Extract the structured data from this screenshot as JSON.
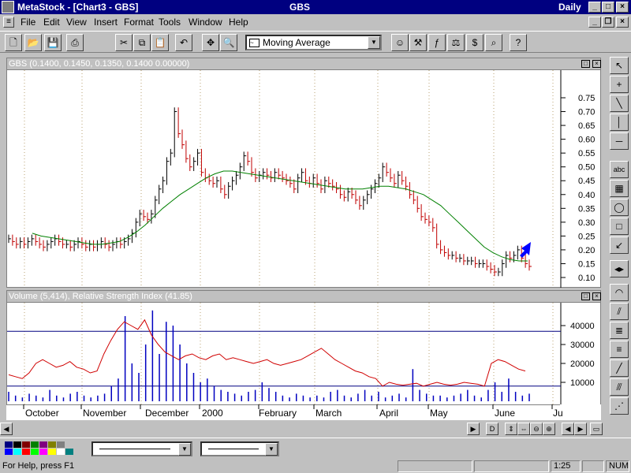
{
  "titlebar": {
    "app": "MetaStock - [Chart3 - GBS]",
    "center": "GBS",
    "right": "Daily"
  },
  "menu": [
    "File",
    "Edit",
    "View",
    "Insert",
    "Format",
    "Tools",
    "Window",
    "Help"
  ],
  "toolbar": {
    "indicator_select": "Moving Average"
  },
  "price_pane": {
    "header": "GBS (0.1400, 0.1450, 0.1350, 0.1400 0.00000)",
    "yticks": [
      "0.75",
      "0.70",
      "0.65",
      "0.60",
      "0.55",
      "0.50",
      "0.45",
      "0.40",
      "0.35",
      "0.30",
      "0.25",
      "0.20",
      "0.15",
      "0.10"
    ]
  },
  "volume_pane": {
    "header": "Volume (5,414), Relative Strength Index (41.85)",
    "yticks": [
      "40000",
      "30000",
      "20000",
      "10000"
    ]
  },
  "xaxis": {
    "labels": [
      "October",
      "November",
      "December",
      "2000",
      "February",
      "March",
      "April",
      "May",
      "June",
      "Ju"
    ]
  },
  "status": {
    "help": "For Help, press F1",
    "time": "1:25",
    "num": "NUM"
  },
  "chart_data": {
    "type": "line",
    "price": {
      "close": [
        0.24,
        0.23,
        0.22,
        0.23,
        0.22,
        0.23,
        0.24,
        0.23,
        0.22,
        0.21,
        0.22,
        0.23,
        0.24,
        0.23,
        0.22,
        0.22,
        0.21,
        0.22,
        0.23,
        0.22,
        0.21,
        0.22,
        0.21,
        0.22,
        0.23,
        0.22,
        0.21,
        0.22,
        0.23,
        0.22,
        0.23,
        0.24,
        0.26,
        0.3,
        0.33,
        0.32,
        0.31,
        0.33,
        0.38,
        0.42,
        0.45,
        0.52,
        0.55,
        0.7,
        0.62,
        0.58,
        0.53,
        0.5,
        0.52,
        0.55,
        0.48,
        0.46,
        0.45,
        0.44,
        0.45,
        0.42,
        0.4,
        0.43,
        0.45,
        0.47,
        0.5,
        0.54,
        0.52,
        0.48,
        0.46,
        0.47,
        0.48,
        0.47,
        0.46,
        0.48,
        0.47,
        0.46,
        0.45,
        0.44,
        0.42,
        0.46,
        0.48,
        0.45,
        0.44,
        0.46,
        0.44,
        0.42,
        0.45,
        0.44,
        0.43,
        0.42,
        0.4,
        0.39,
        0.41,
        0.4,
        0.38,
        0.36,
        0.38,
        0.4,
        0.42,
        0.44,
        0.46,
        0.5,
        0.48,
        0.46,
        0.44,
        0.47,
        0.45,
        0.43,
        0.4,
        0.38,
        0.35,
        0.32,
        0.31,
        0.3,
        0.28,
        0.22,
        0.2,
        0.19,
        0.18,
        0.18,
        0.17,
        0.17,
        0.16,
        0.16,
        0.16,
        0.15,
        0.15,
        0.15,
        0.14,
        0.13,
        0.12,
        0.12,
        0.15,
        0.18,
        0.17,
        0.18,
        0.2,
        0.17,
        0.15,
        0.14
      ],
      "moving_average": [
        0.26,
        0.25,
        0.245,
        0.24,
        0.235,
        0.23,
        0.225,
        0.22,
        0.22,
        0.225,
        0.23,
        0.245,
        0.265,
        0.29,
        0.32,
        0.35,
        0.375,
        0.4,
        0.42,
        0.44,
        0.46,
        0.475,
        0.485,
        0.485,
        0.48,
        0.475,
        0.47,
        0.465,
        0.46,
        0.455,
        0.45,
        0.445,
        0.44,
        0.435,
        0.43,
        0.425,
        0.42,
        0.42,
        0.42,
        0.425,
        0.43,
        0.43,
        0.425,
        0.42,
        0.41,
        0.4,
        0.38,
        0.36,
        0.33,
        0.3,
        0.27,
        0.24,
        0.21,
        0.19,
        0.175,
        0.165,
        0.16,
        0.16
      ]
    },
    "volume_rsi": {
      "rsi_scaled": [
        14000,
        13000,
        12000,
        15000,
        20000,
        22000,
        20000,
        18000,
        19000,
        21000,
        18000,
        17000,
        15000,
        16000,
        25000,
        32000,
        38000,
        42000,
        40000,
        38000,
        43000,
        35000,
        30000,
        26000,
        24000,
        22000,
        24000,
        25000,
        23000,
        22000,
        24000,
        25000,
        22000,
        23000,
        22000,
        21000,
        20000,
        21000,
        22000,
        20000,
        19000,
        20000,
        21000,
        22000,
        24000,
        26000,
        28000,
        25000,
        22000,
        20000,
        18000,
        16000,
        15000,
        13000,
        12000,
        8000,
        10000,
        9000,
        8500,
        9000,
        9500,
        8000,
        9000,
        10000,
        9000,
        8500,
        9000,
        10000,
        9500,
        9000,
        8000,
        20000,
        22000,
        21000,
        19000,
        17000,
        16000
      ],
      "volume": [
        5000,
        3000,
        2000,
        4000,
        3000,
        2000,
        6000,
        3000,
        2000,
        4000,
        5000,
        3000,
        2000,
        3000,
        4000,
        8000,
        12000,
        45000,
        20000,
        15000,
        30000,
        48000,
        25000,
        42000,
        40000,
        30000,
        20000,
        15000,
        10000,
        12000,
        8000,
        6000,
        5000,
        4000,
        3000,
        5000,
        6000,
        10000,
        7000,
        5000,
        3000,
        2000,
        4000,
        3000,
        2000,
        3000,
        2000,
        5000,
        6000,
        3000,
        2000,
        4000,
        6000,
        3000,
        5000,
        2000,
        3000,
        4000,
        2000,
        17000,
        6000,
        4000,
        3000,
        3000,
        2000,
        3000,
        4000,
        6000,
        3000,
        2000,
        6000,
        10000,
        5000,
        12000,
        5000,
        3000,
        4000
      ],
      "ylim": [
        0,
        50000
      ],
      "hlines": [
        37000,
        8000
      ]
    }
  }
}
